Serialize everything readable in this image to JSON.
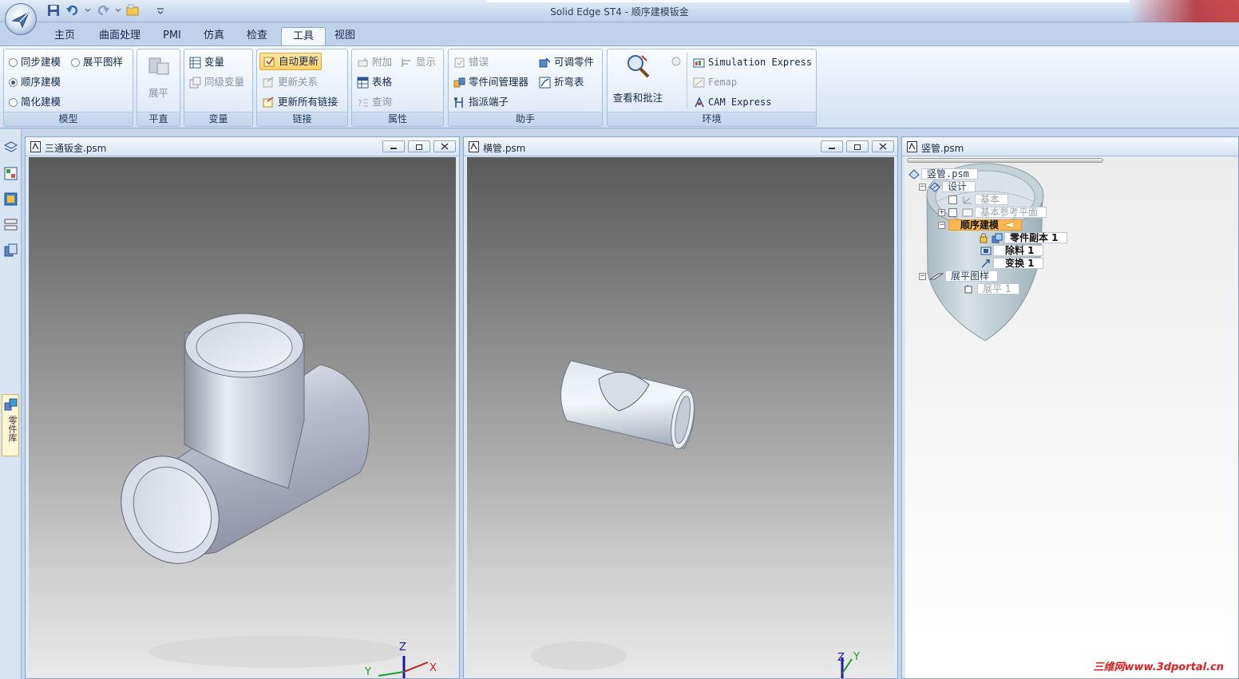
{
  "window": {
    "title": "Solid Edge ST4 - 顺序建模钣金"
  },
  "tabs": [
    "主页",
    "曲面处理",
    "PMI",
    "仿真",
    "检查",
    "工具",
    "视图"
  ],
  "active_tab": "工具",
  "ribbon": {
    "model": {
      "label": "模型",
      "sync": "同步建模",
      "ordered": "顺序建模",
      "simplify": "简化建模",
      "flat_pattern": "展平图样"
    },
    "flat": {
      "label": "平直",
      "unfold": "展平"
    },
    "variables": {
      "label": "变量",
      "variable": "变量",
      "inter_variable": "同级变量"
    },
    "links": {
      "label": "链接",
      "auto_update": "自动更新",
      "update_relations": "更新关系",
      "update_all_links": "更新所有链接"
    },
    "properties": {
      "label": "属性",
      "attach": "附加",
      "display": "显示",
      "table": "表格",
      "query": "查询"
    },
    "assistant": {
      "label": "助手",
      "errors": "错误",
      "adjustable_part": "可调零件",
      "part_manager": "零件间管理器",
      "bend_table": "折弯表",
      "assign_terminal": "指派端子"
    },
    "environment": {
      "label": "环境",
      "review": "查看和批注",
      "sim_express": "Simulation Express",
      "femap": "Femap",
      "cam_express": "CAM Express"
    }
  },
  "dock": {
    "part_library_tab": "零件库"
  },
  "windows": [
    {
      "title": "三通钣金.psm"
    },
    {
      "title": "横管.psm"
    },
    {
      "title": "竖管.psm"
    }
  ],
  "axes": {
    "z": "Z",
    "x": "X",
    "y": "Y"
  },
  "tree": {
    "root": "竖管.psm",
    "design": "设计",
    "base": "基本",
    "base_planes": "基本参考平面",
    "ordered": "顺序建模",
    "part_copy": "零件副本 1",
    "cutout": "除料 1",
    "transform": "变换 1",
    "flat_pattern": "展平图样",
    "flatten": "展平 1"
  },
  "watermark": "三维网www.3dportal.cn"
}
